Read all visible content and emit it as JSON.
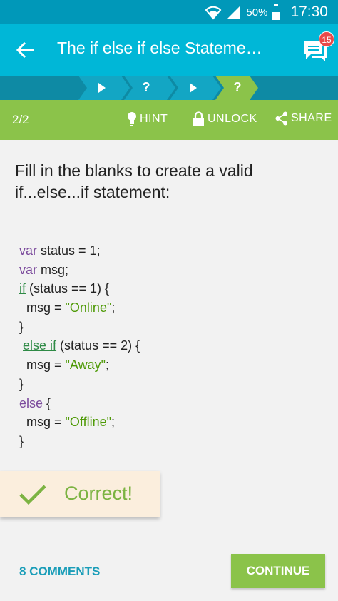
{
  "status_bar": {
    "battery": "50%",
    "time": "17:30"
  },
  "app_bar": {
    "title": "The if else if else Stateme…",
    "badge_count": "15"
  },
  "progress": {
    "steps": [
      "play",
      "?",
      "play",
      "?"
    ],
    "active_step": 3
  },
  "toolbar": {
    "counter": "2/2",
    "hint": "HINT",
    "unlock": "UNLOCK",
    "share": "SHARE"
  },
  "question": "Fill in the blanks to create a valid if...else...if statement:",
  "code": {
    "l1_kw": "var",
    "l1_rest": " status = 1;",
    "l2_kw": "var",
    "l2_rest": " msg;",
    "l3_blank": "if",
    "l3_rest": " (status == 1) {",
    "l4_pre": "  msg = ",
    "l4_str": "\"Online\"",
    "l4_end": ";",
    "l5": "}",
    "l6_blank": "else if",
    "l6_rest": " (status == 2) {",
    "l7_pre": "  msg = ",
    "l7_str": "\"Away\"",
    "l7_end": ";",
    "l8": "}",
    "l9_kw": "else",
    "l9_rest": " {",
    "l10_pre": "  msg = ",
    "l10_str": "\"Offline\"",
    "l10_end": ";",
    "l11": "}"
  },
  "result": {
    "label": "Correct!"
  },
  "footer": {
    "comments": "8 COMMENTS",
    "continue": "CONTINUE"
  },
  "colors": {
    "status_bar": "#0098b9",
    "app_bar": "#00b7d7",
    "toolbar": "#8bc34a",
    "accent_link": "#1a9db8",
    "success": "#7cb342"
  }
}
